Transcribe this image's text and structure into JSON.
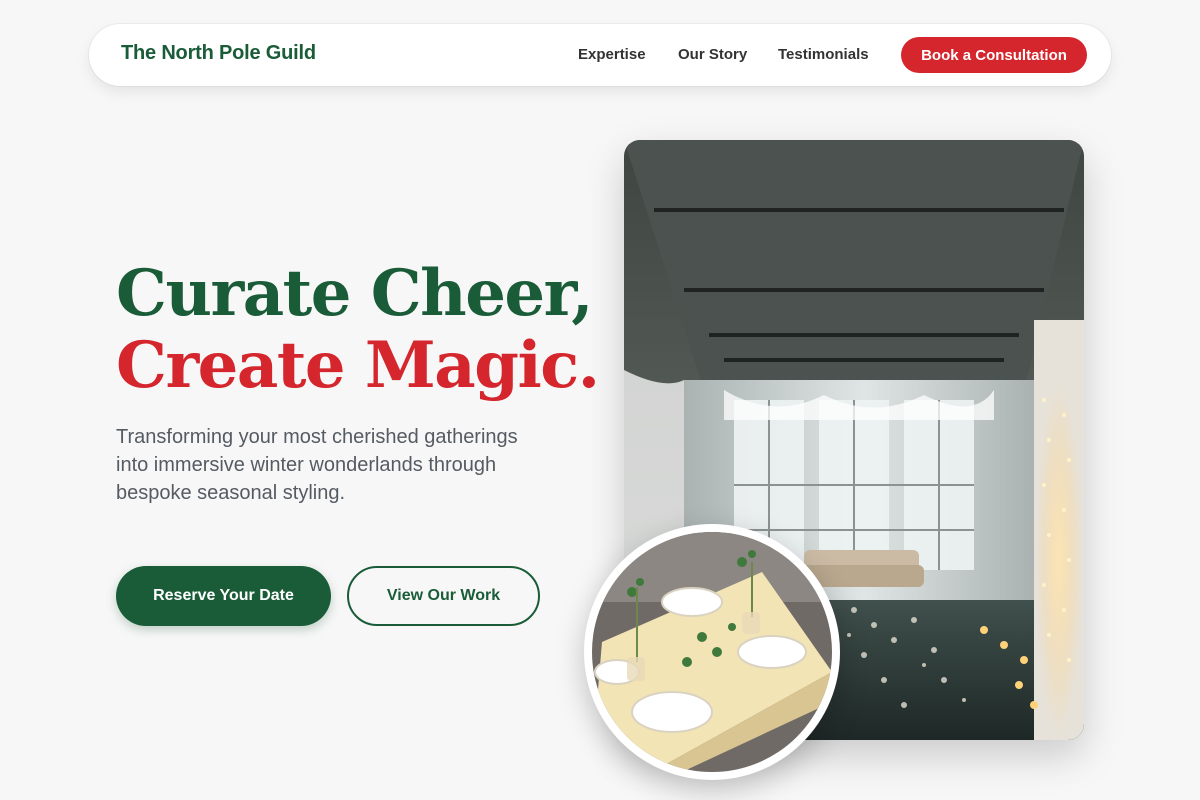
{
  "nav": {
    "brand": "The North Pole Guild",
    "links": [
      "Expertise",
      "Our Story",
      "Testimonials"
    ],
    "cta": "Book a Consultation"
  },
  "hero": {
    "title_line1": "Curate Cheer,",
    "title_line2": "Create Magic.",
    "subtitle": "Transforming your most cherished gatherings into immersive winter wonderlands through bespoke seasonal styling.",
    "primary_button": "Reserve Your Date",
    "secondary_button": "View Our Work"
  },
  "colors": {
    "brand_green": "#1a5c38",
    "brand_red": "#d4262c",
    "background": "#f7f7f7"
  },
  "images": {
    "main": "loft-venue-photo",
    "inset": "table-setting-photo"
  }
}
